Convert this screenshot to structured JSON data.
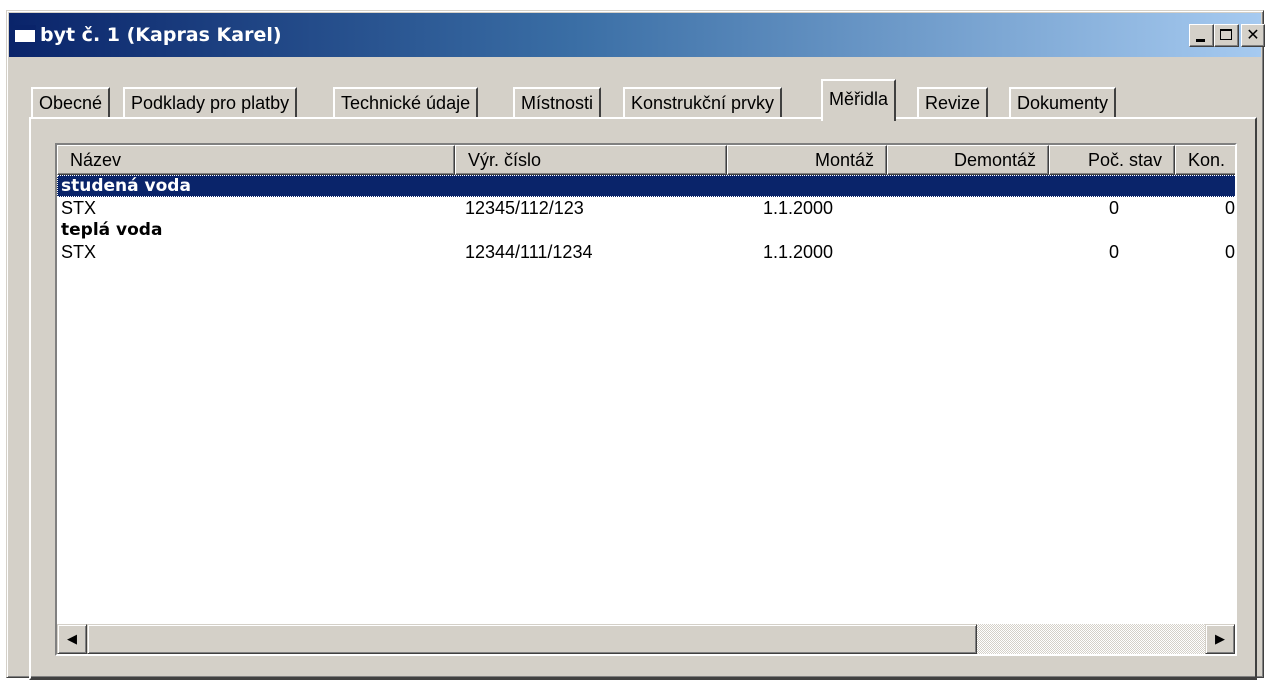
{
  "window": {
    "title": "byt č. 1 (Kapras Karel)"
  },
  "tabs": [
    {
      "label": "Obecné"
    },
    {
      "label": "Podklady pro platby"
    },
    {
      "label": "Technické údaje"
    },
    {
      "label": "Místnosti"
    },
    {
      "label": "Konstrukční prvky"
    },
    {
      "label": "Měřidla",
      "active": true
    },
    {
      "label": "Revize"
    },
    {
      "label": "Dokumenty"
    }
  ],
  "list": {
    "columns": [
      "Název",
      "Výr. číslo",
      "Montáž",
      "Demontáž",
      "Poč. stav",
      "Kon."
    ],
    "rows": [
      {
        "group": true,
        "selected": true,
        "cells": [
          "studená voda",
          "",
          "",
          "",
          "",
          ""
        ]
      },
      {
        "group": false,
        "cells": [
          "STX",
          "12345/112/123",
          "1.1.2000",
          "",
          "0",
          "0"
        ]
      },
      {
        "group": true,
        "cells": [
          "teplá voda",
          "",
          "",
          "",
          "",
          ""
        ]
      },
      {
        "group": false,
        "cells": [
          "STX",
          "12344/111/1234",
          "1.1.2000",
          "",
          "0",
          "0"
        ]
      }
    ]
  },
  "icons": {
    "app": "window-icon",
    "minimize": "minimize-icon",
    "maximize": "maximize-icon",
    "close": "close-icon",
    "scroll_left": "arrow-left-icon",
    "scroll_right": "arrow-right-icon"
  },
  "scroll": {
    "left_glyph": "◀",
    "right_glyph": "▶"
  }
}
